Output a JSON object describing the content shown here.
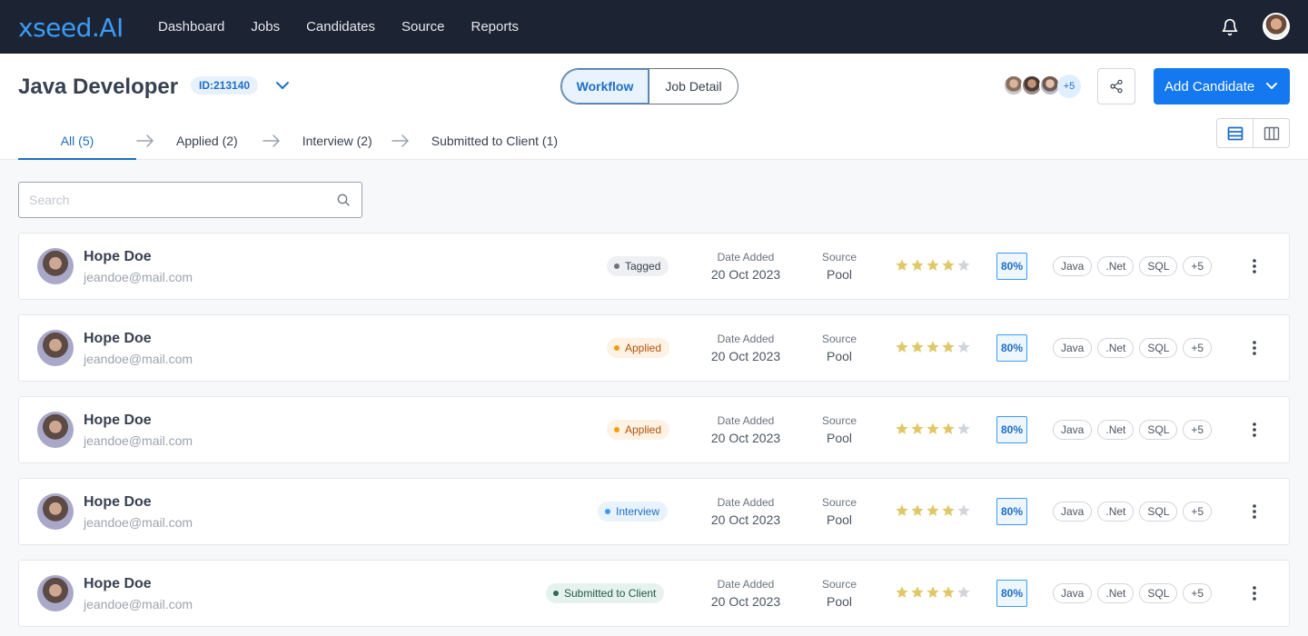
{
  "nav": {
    "logo_main": "xseed",
    "logo_suffix": ".AI",
    "links": [
      "Dashboard",
      "Jobs",
      "Candidates",
      "Source",
      "Reports"
    ]
  },
  "job": {
    "title": "Java Developer",
    "id": "ID:213140",
    "view_tabs": {
      "workflow": "Workflow",
      "job_detail": "Job Detail"
    },
    "team_more": "+5",
    "add_candidate": "Add Candidate"
  },
  "stages": [
    {
      "label": "All (5)"
    },
    {
      "label": "Applied (2)"
    },
    {
      "label": "Interview (2)"
    },
    {
      "label": "Submitted to Client (1)"
    }
  ],
  "search": {
    "placeholder": "Search",
    "value": ""
  },
  "labels": {
    "date_added": "Date Added",
    "source": "Source"
  },
  "candidates": [
    {
      "name": "Hope Doe",
      "email": "jeandoe@mail.com",
      "status": "Tagged",
      "date": "20 Oct 2023",
      "source": "Pool",
      "rating": 4,
      "score": "80%",
      "skills": [
        "Java",
        ".Net",
        "SQL",
        "+5"
      ]
    },
    {
      "name": "Hope Doe",
      "email": "jeandoe@mail.com",
      "status": "Applied",
      "date": "20 Oct 2023",
      "source": "Pool",
      "rating": 4,
      "score": "80%",
      "skills": [
        "Java",
        ".Net",
        "SQL",
        "+5"
      ]
    },
    {
      "name": "Hope Doe",
      "email": "jeandoe@mail.com",
      "status": "Applied",
      "date": "20 Oct 2023",
      "source": "Pool",
      "rating": 4,
      "score": "80%",
      "skills": [
        "Java",
        ".Net",
        "SQL",
        "+5"
      ]
    },
    {
      "name": "Hope Doe",
      "email": "jeandoe@mail.com",
      "status": "Interview",
      "date": "20 Oct 2023",
      "source": "Pool",
      "rating": 4,
      "score": "80%",
      "skills": [
        "Java",
        ".Net",
        "SQL",
        "+5"
      ]
    },
    {
      "name": "Hope Doe",
      "email": "jeandoe@mail.com",
      "status": "Submitted to Client",
      "date": "20 Oct 2023",
      "source": "Pool",
      "rating": 4,
      "score": "80%",
      "skills": [
        "Java",
        ".Net",
        "SQL",
        "+5"
      ]
    }
  ],
  "colors": {
    "nav_bg": "#1c2434",
    "accent": "#1478f0",
    "star": "#e0c868",
    "star_empty": "#d1d5db"
  },
  "icons": [
    "bell-icon",
    "chevron-down-icon",
    "share-icon",
    "list-view-icon",
    "board-view-icon",
    "search-icon",
    "star-icon",
    "more-vertical-icon",
    "arrow-right-icon"
  ]
}
